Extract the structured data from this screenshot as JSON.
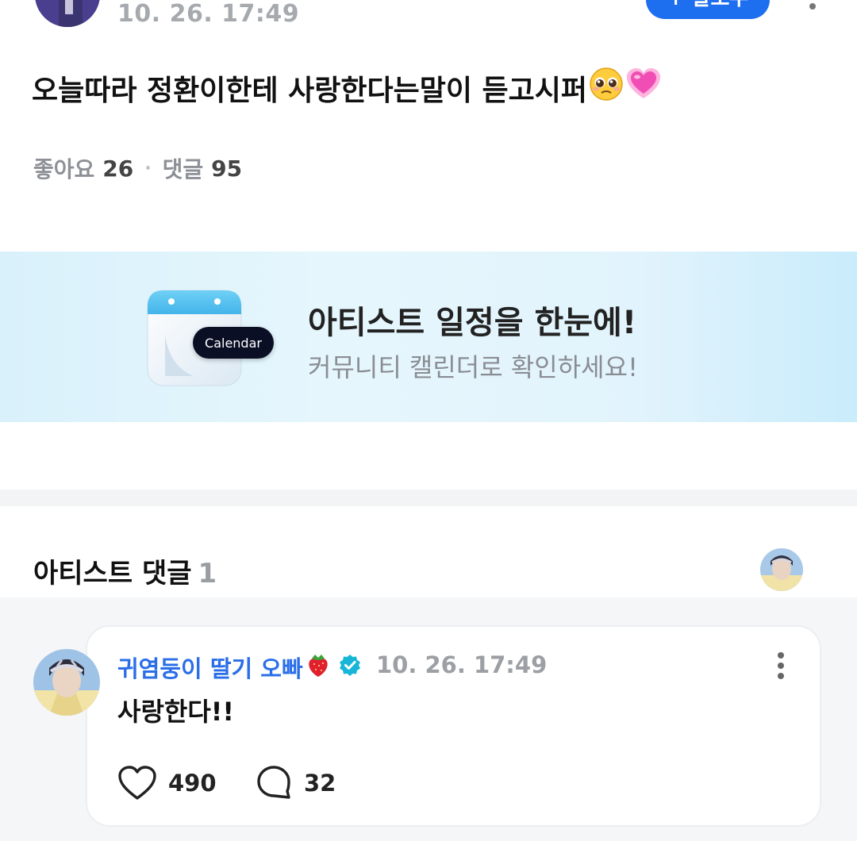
{
  "post": {
    "timestamp": "10. 26. 17:49",
    "follow_label": "+ 팔로우",
    "body_text": "오늘따라 정환이한테 사랑한다는말이 듣고시퍼",
    "body_emojis": [
      "pleading-face",
      "growing-heart"
    ],
    "likes_label": "좋아요",
    "likes_count": "26",
    "comments_label": "댓글",
    "comments_count": "95"
  },
  "banner": {
    "title": "아티스트 일정을 한눈에!",
    "subtitle": "커뮤니티 캘린더로 확인하세요!",
    "calendar_pill": "Calendar",
    "icon": "calendar-icon"
  },
  "artist_comments": {
    "header": "아티스트 댓글",
    "count": "1",
    "items": [
      {
        "author": "귀염둥이 딸기 오빠",
        "author_emoji": "strawberry",
        "verified": true,
        "timestamp": "10. 26. 17:49",
        "text": "사랑한다!!",
        "likes": "490",
        "replies": "32"
      }
    ]
  },
  "colors": {
    "accent": "#1e6ff0",
    "author_blue": "#2a6ee8",
    "verified_teal": "#17b6d8",
    "muted": "#9c9fa4",
    "banner_bg": "#e1f3fc"
  }
}
